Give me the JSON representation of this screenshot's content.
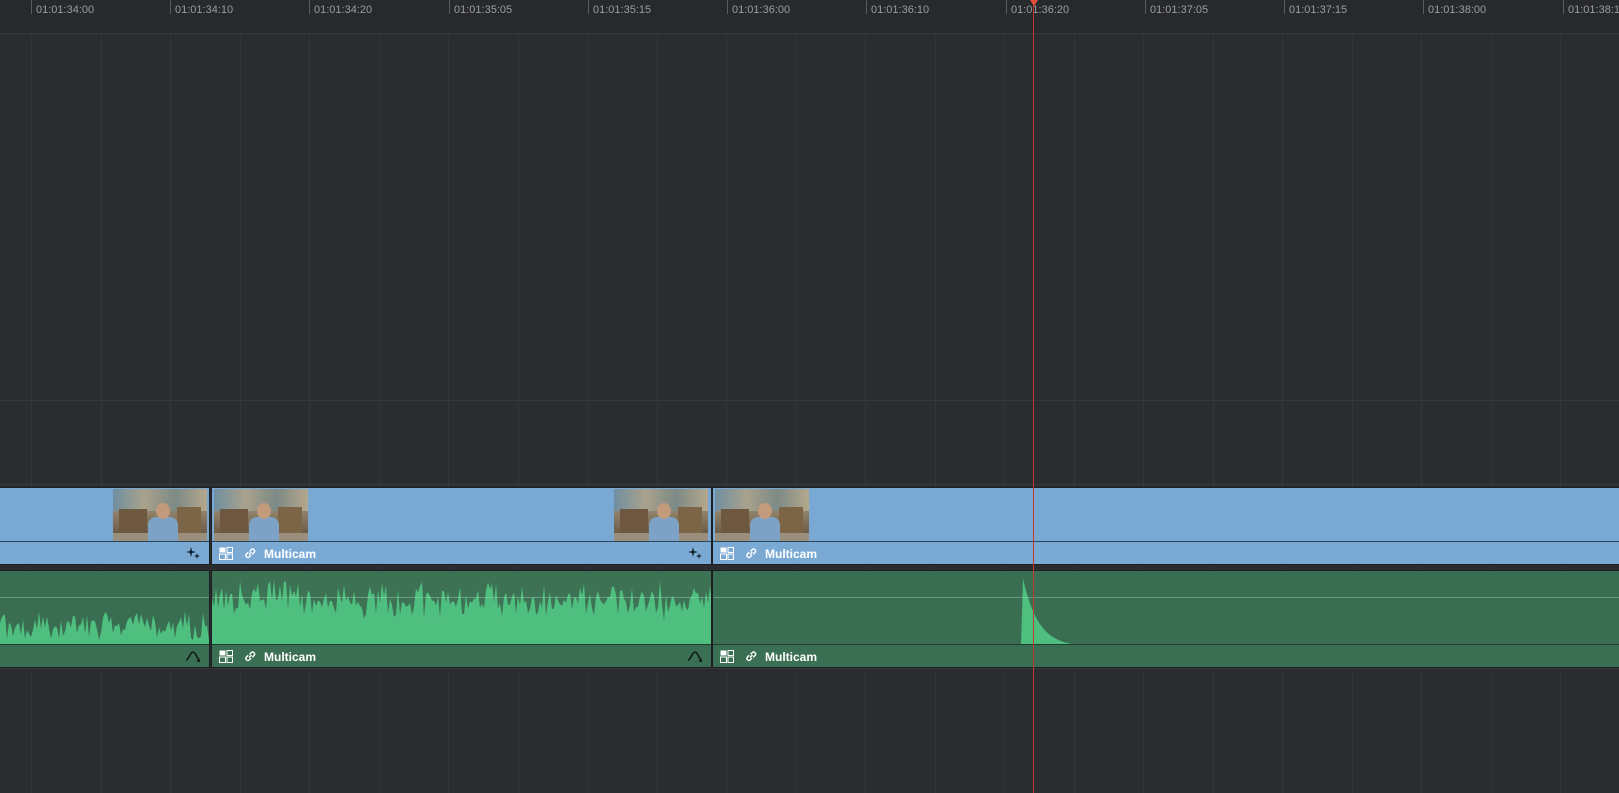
{
  "ruler": {
    "timecodes": [
      "01:01:34:00",
      "01:01:34:10",
      "01:01:34:20",
      "01:01:35:05",
      "01:01:35:15",
      "01:01:36:00",
      "01:01:36:10",
      "01:01:36:20",
      "01:01:37:05",
      "01:01:37:15",
      "01:01:38:00",
      "01:01:38:1"
    ]
  },
  "playhead": {
    "timecode": "01:01:36:20"
  },
  "video_track": {
    "clips": [
      {
        "label": ""
      },
      {
        "label": "Multicam"
      },
      {
        "label": "Multicam"
      }
    ]
  },
  "audio_track": {
    "clips": [
      {
        "label": ""
      },
      {
        "label": "Multicam"
      },
      {
        "label": "Multicam"
      }
    ]
  },
  "colors": {
    "video_clip": "#79a8d3",
    "audio_clip": "#3a6e52",
    "waveform": "#4fbf7f",
    "playhead": "#e74c3c",
    "background": "#2b2c30"
  },
  "icons": {
    "multicam": "multicam-icon",
    "link": "link-icon",
    "effects": "effects-sparkle-icon",
    "audio_fade": "audio-curve-icon"
  }
}
